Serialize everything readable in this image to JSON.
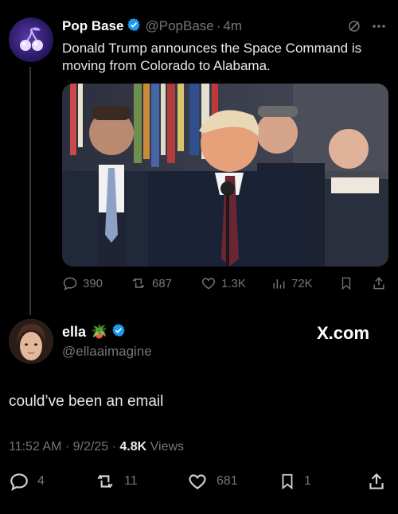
{
  "tweet": {
    "display_name": "Pop Base",
    "handle": "@PopBase",
    "separator": "·",
    "time": "4m",
    "text": "Donald Trump announces the Space Command is moving from Colorado to Alabama.",
    "stats": {
      "replies": "390",
      "retweets": "687",
      "likes": "1.3K",
      "views": "72K"
    }
  },
  "reply": {
    "display_name": "ella",
    "emoji": "🪴",
    "handle": "@ellaaimagine",
    "text": "could’ve been an email",
    "time": "11:52 AM",
    "date": "9/2/25",
    "views_count": "4.8K",
    "views_label": "Views",
    "stats": {
      "replies": "4",
      "retweets": "11",
      "likes": "681",
      "bookmarks": "1"
    }
  },
  "watermark": "X.com",
  "colors": {
    "background": "#000000",
    "verified": "#1d9bf0",
    "muted": "#71767b"
  }
}
